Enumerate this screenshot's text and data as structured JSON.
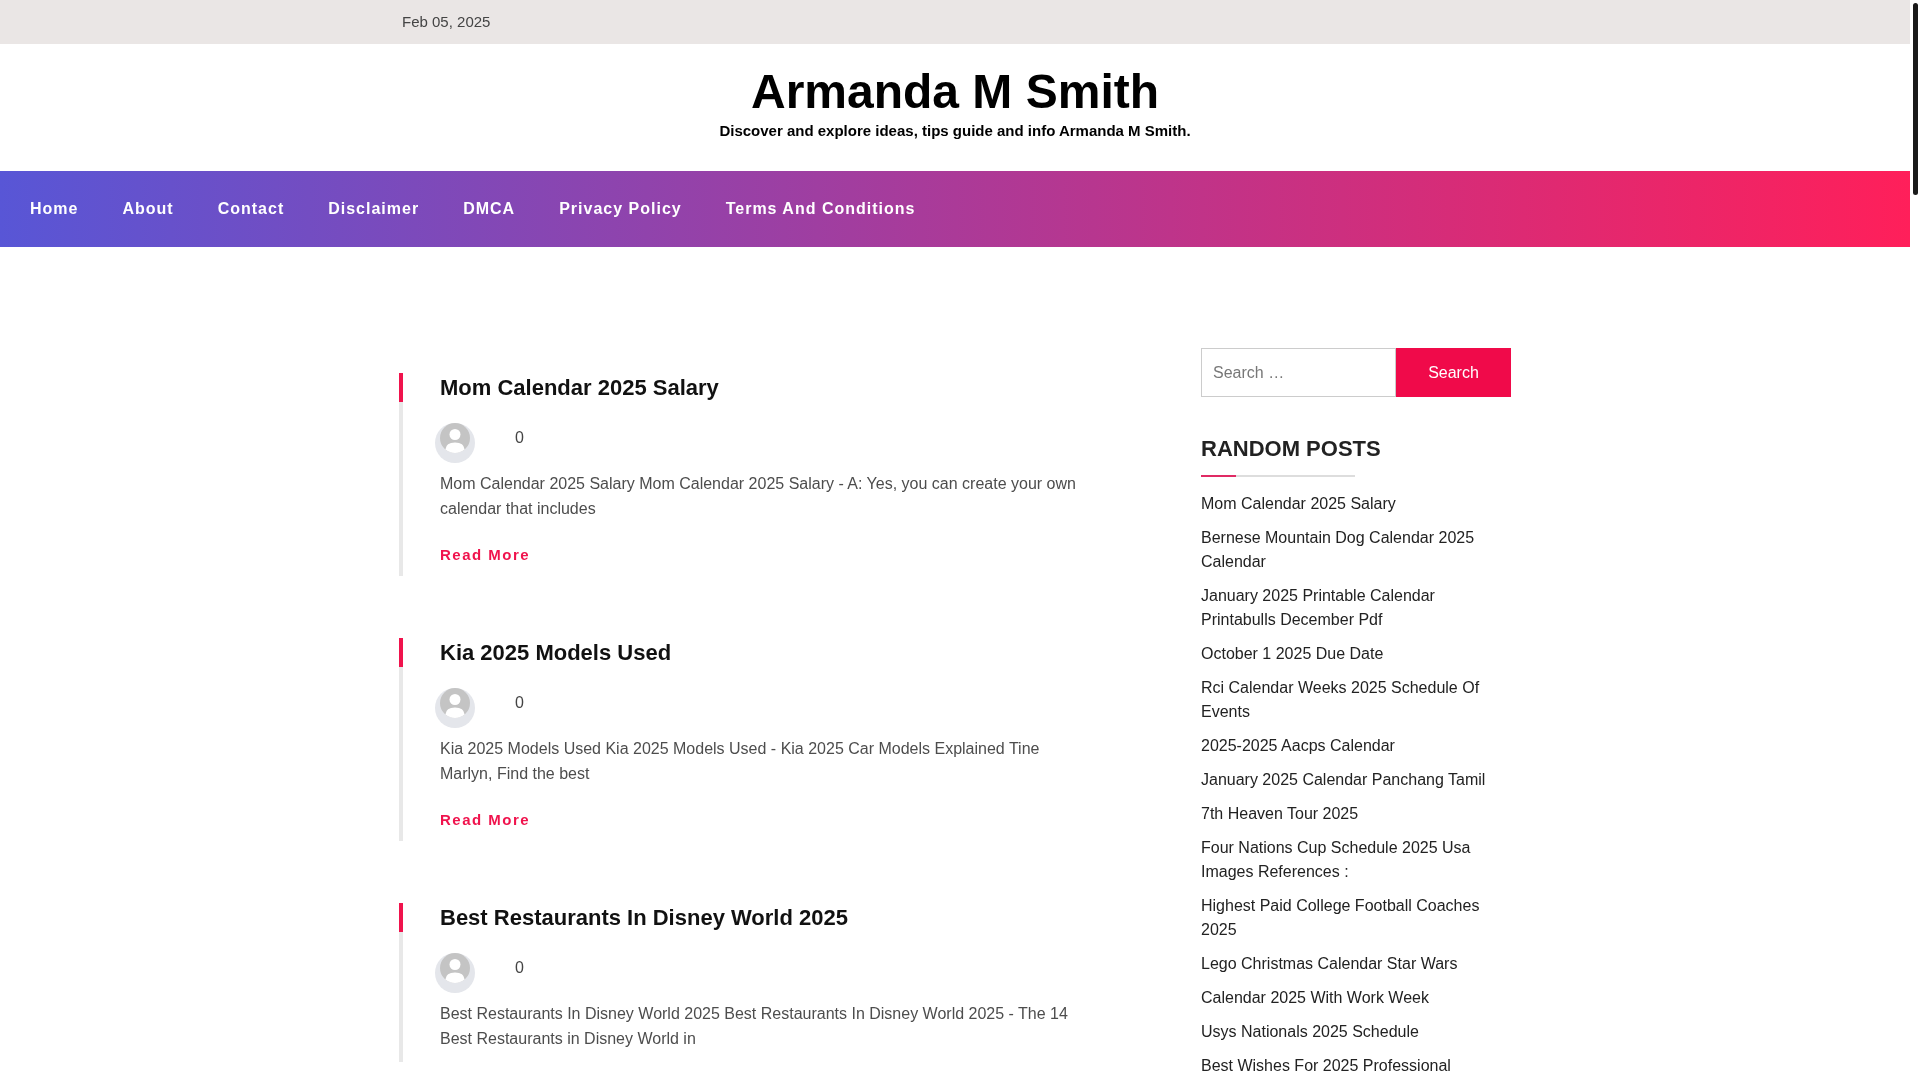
{
  "top_bar": {
    "date": "Feb 05, 2025"
  },
  "header": {
    "site_title": "Armanda M Smith",
    "tagline": "Discover and explore ideas, tips guide and info Armanda M Smith."
  },
  "nav": {
    "items": [
      "Home",
      "About",
      "Contact",
      "Disclaimer",
      "DMCA",
      "Privacy Policy",
      "Terms And Conditions"
    ]
  },
  "posts": [
    {
      "title": "Mom Calendar 2025 Salary",
      "comment_count": "0",
      "excerpt": "Mom Calendar 2025 Salary Mom Calendar 2025 Salary - A: Yes, you can create your own calendar that includes",
      "read_more": "Read More"
    },
    {
      "title": "Kia 2025 Models Used",
      "comment_count": "0",
      "excerpt": "Kia 2025 Models Used Kia 2025 Models Used - Kia 2025 Car Models Explained Tine Marlyn, Find the best",
      "read_more": "Read More"
    },
    {
      "title": "Best Restaurants In Disney World 2025",
      "comment_count": "0",
      "excerpt": "Best Restaurants In Disney World 2025 Best Restaurants In Disney World 2025 - The 14 Best Restaurants in Disney World in"
    }
  ],
  "sidebar": {
    "search": {
      "placeholder": "Search …",
      "button": "Search"
    },
    "random_posts": {
      "heading": "RANDOM POSTS",
      "items": [
        "Mom Calendar 2025 Salary",
        "Bernese Mountain Dog Calendar 2025 Calendar",
        "January 2025 Printable Calendar Printabulls December Pdf",
        "October 1 2025 Due Date",
        "Rci Calendar Weeks 2025 Schedule Of Events",
        "2025-2025 Aacps Calendar",
        "January 2025 Calendar Panchang Tamil",
        "7th Heaven Tour 2025",
        "Four Nations Cup Schedule 2025 Usa Images References :",
        "Highest Paid College Football Coaches 2025",
        "Lego Christmas Calendar Star Wars",
        "Calendar 2025 With Work Week",
        "Usys Nationals 2025 Schedule",
        "Best Wishes For 2025 Professional"
      ]
    }
  }
}
